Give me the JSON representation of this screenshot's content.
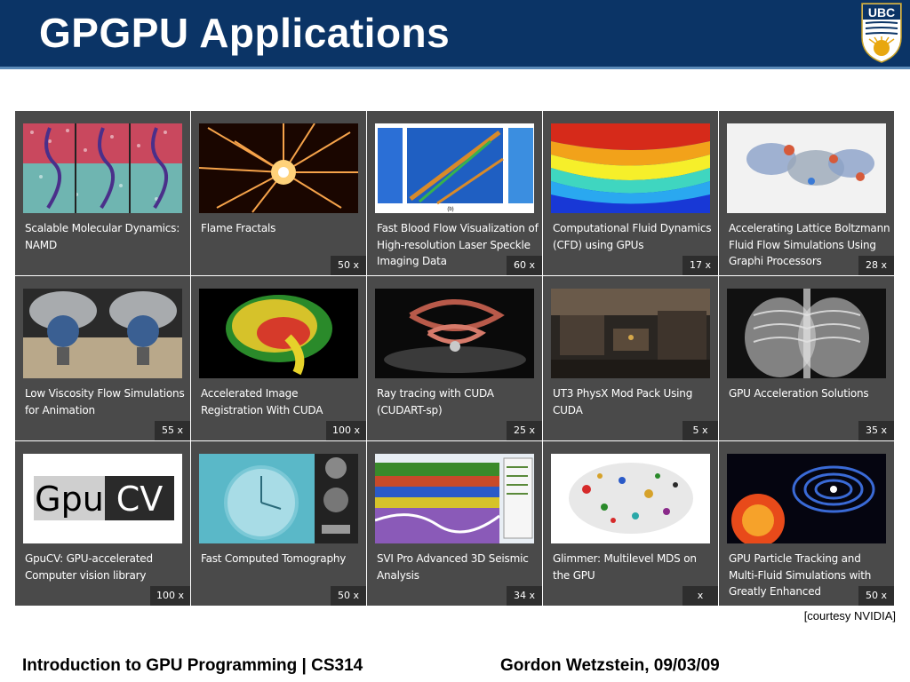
{
  "header": {
    "title": "GPGPU Applications",
    "logo_text": "UBC",
    "background_color": "#0b3466"
  },
  "tiles": [
    {
      "caption": "Scalable Molecular Dynamics: NAMD",
      "speedup": "",
      "image": "molecular-dynamics-image"
    },
    {
      "caption": "Flame Fractals",
      "speedup": "50 x",
      "image": "flame-fractal-image"
    },
    {
      "caption": "Fast Blood Flow Visualization of High-resolution Laser Speckle Imaging Data",
      "speedup": "60 x",
      "image": "blood-flow-image"
    },
    {
      "caption": "Computational Fluid Dynamics (CFD) using GPUs",
      "speedup": "17 x",
      "image": "cfd-image"
    },
    {
      "caption": "Accelerating Lattice Boltzmann Fluid Flow Simulations Using Graphi Processors",
      "speedup": "28 x",
      "image": "lattice-boltzmann-image"
    },
    {
      "caption": "Low Viscosity Flow Simulations for Animation",
      "speedup": "55 x",
      "image": "smoke-sphere-image"
    },
    {
      "caption": "Accelerated Image Registration With CUDA",
      "speedup": "100 x",
      "image": "brain-mri-image"
    },
    {
      "caption": "Ray tracing with CUDA (CUDART-sp)",
      "speedup": "25 x",
      "image": "ray-tracing-image"
    },
    {
      "caption": "UT3 PhysX Mod Pack Using CUDA",
      "speedup": "5 x",
      "image": "game-scene-image"
    },
    {
      "caption": "GPU Acceleration Solutions",
      "speedup": "35 x",
      "image": "xray-image"
    },
    {
      "caption": "GpuCV: GPU-accelerated Computer vision library",
      "speedup": "100 x",
      "image": "gpucv-logo-image",
      "logo_text_a": "Gpu",
      "logo_text_b": "CV"
    },
    {
      "caption": "Fast Computed Tomography",
      "speedup": "50 x",
      "image": "tomography-watch-image"
    },
    {
      "caption": "SVI Pro Advanced 3D Seismic Analysis",
      "speedup": "34 x",
      "image": "seismic-image"
    },
    {
      "caption": "Glimmer: Multilevel MDS on the GPU",
      "speedup": "x",
      "image": "mds-scatter-image"
    },
    {
      "caption": "GPU Particle Tracking and Multi-Fluid Simulations with Greatly Enhanced Computational Speed",
      "speedup": "50 x",
      "image": "particle-tracking-image"
    }
  ],
  "courtesy": "[courtesy NVIDIA]",
  "footer": {
    "left": "Introduction to GPU Programming | CS314",
    "right": "Gordon Wetzstein, 09/03/09"
  }
}
